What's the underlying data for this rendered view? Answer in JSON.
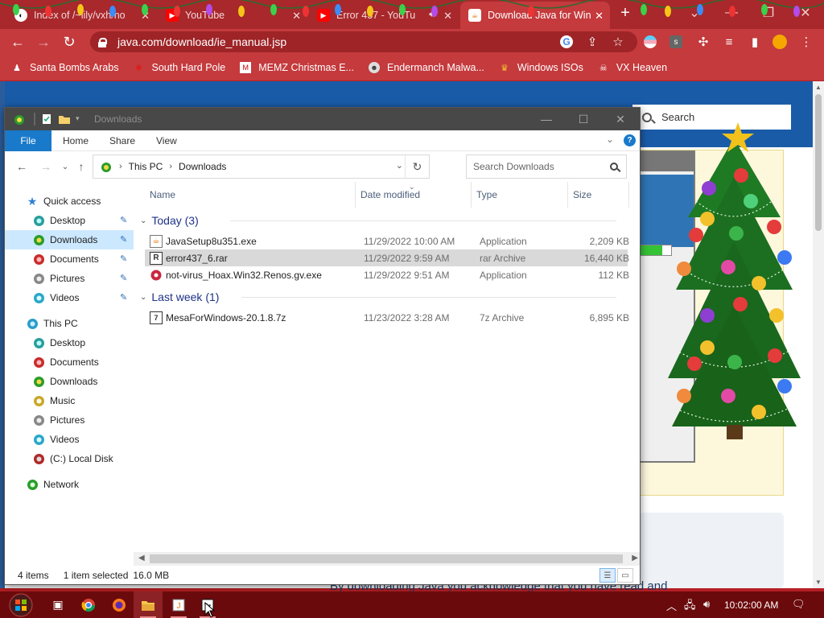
{
  "browser": {
    "tabs": [
      {
        "title": "Index of /~lily/vxh/no",
        "active": false
      },
      {
        "title": "YouTube",
        "active": false
      },
      {
        "title": "Error 437 - YouTu",
        "active": false
      },
      {
        "title": "Download Java for Win",
        "active": true
      }
    ],
    "url": "java.com/download/ie_manual.jsp",
    "bookmarks": [
      {
        "label": "Santa Bombs Arabs",
        "icon": "santa-icon"
      },
      {
        "label": "South Hard Pole",
        "icon": "maple-leaf-icon"
      },
      {
        "label": "MEMZ Christmas E...",
        "icon": "memz-icon"
      },
      {
        "label": "Endermanch Malwa...",
        "icon": "endermanch-icon"
      },
      {
        "label": "Windows ISOs",
        "icon": "trophy-icon"
      },
      {
        "label": "VX Heaven",
        "icon": "vx-heaven-icon"
      }
    ],
    "profile_letter": "s"
  },
  "webpage": {
    "search_label": "Search",
    "footer_text": "By downloading Java you acknowledge that you have read and"
  },
  "explorer": {
    "title": "Downloads",
    "ribbon_tabs": [
      "File",
      "Home",
      "Share",
      "View"
    ],
    "help": "?",
    "breadcrumb": [
      "This PC",
      "Downloads"
    ],
    "search_placeholder": "Search Downloads",
    "columns": [
      "Name",
      "Date modified",
      "Type",
      "Size"
    ],
    "nav": {
      "quick_access": "Quick access",
      "quick_items": [
        {
          "label": "Desktop",
          "icon": "desktop-icon",
          "pinned": true
        },
        {
          "label": "Downloads",
          "icon": "downloads-icon",
          "pinned": true,
          "selected": true
        },
        {
          "label": "Documents",
          "icon": "documents-icon",
          "pinned": true
        },
        {
          "label": "Pictures",
          "icon": "pictures-icon",
          "pinned": true
        },
        {
          "label": "Videos",
          "icon": "videos-icon",
          "pinned": true
        }
      ],
      "this_pc": "This PC",
      "pc_items": [
        {
          "label": "Desktop",
          "icon": "desktop-icon"
        },
        {
          "label": "Documents",
          "icon": "documents-icon"
        },
        {
          "label": "Downloads",
          "icon": "downloads-icon"
        },
        {
          "label": "Music",
          "icon": "music-icon"
        },
        {
          "label": "Pictures",
          "icon": "pictures-icon"
        },
        {
          "label": "Videos",
          "icon": "videos-icon"
        },
        {
          "label": "(C:) Local Disk",
          "icon": "local-disk-icon"
        }
      ],
      "network": "Network"
    },
    "groups": [
      {
        "label": "Today (3)",
        "files": [
          {
            "name": "JavaSetup8u351.exe",
            "date": "11/29/2022 10:00 AM",
            "type": "Application",
            "size": "2,209 KB",
            "icon": "java-installer-icon",
            "selected": false
          },
          {
            "name": "error437_6.rar",
            "date": "11/29/2022 9:59 AM",
            "type": "rar Archive",
            "size": "16,440 KB",
            "icon": "rar-archive-icon",
            "selected": true
          },
          {
            "name": "not-virus_Hoax.Win32.Renos.gv.exe",
            "date": "11/29/2022 9:51 AM",
            "type": "Application",
            "size": "112 KB",
            "icon": "shield-app-icon",
            "selected": false
          }
        ]
      },
      {
        "label": "Last week (1)",
        "files": [
          {
            "name": "MesaForWindows-20.1.8.7z",
            "date": "11/23/2022 3:28 AM",
            "type": "7z Archive",
            "size": "6,895 KB",
            "icon": "7z-archive-icon",
            "selected": false
          }
        ]
      }
    ],
    "status": {
      "items": "4 items",
      "selected": "1 item selected",
      "size": "16.0 MB"
    }
  },
  "taskbar": {
    "clock": "10:02:00 AM",
    "apps": [
      "task-view-icon",
      "chrome-icon",
      "firefox-icon",
      "file-explorer-icon",
      "java-installer-icon",
      "7zip-icon"
    ]
  },
  "colors": {
    "chrome_frame": "#a8282c",
    "chrome_toolbar": "#c43a3d",
    "explorer_accent": "#1979ca",
    "selection": "#cce8ff",
    "taskbar": "#6b0a0c",
    "java_header": "#1a5ba8"
  }
}
